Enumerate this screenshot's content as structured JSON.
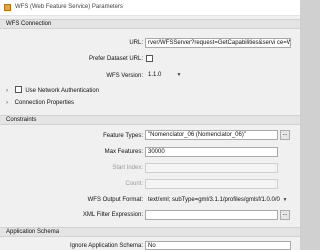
{
  "window": {
    "title": "WFS (Web Feature Service) Parameters"
  },
  "sections": {
    "wfs_connection": "WFS Connection",
    "constraints": "Constraints",
    "application_schema": "Application Schema"
  },
  "wfs_connection": {
    "url_label": "URL:",
    "url_value": "rver/WFSServer?request=GetCapabilities&servi ce=WFS",
    "prefer_dataset_url_label": "Prefer Dataset URL:",
    "prefer_dataset_url_checked": false,
    "wfs_version_label": "WFS Version:",
    "wfs_version_value": "1.1.0",
    "network_auth_label": "Use Network Authentication",
    "connection_properties_label": "Connection Properties"
  },
  "constraints": {
    "feature_types_label": "Feature Types:",
    "feature_types_value": "\"Nomenclator_06 (Nomenclator_06)\"",
    "max_features_label": "Max Features:",
    "max_features_value": "30000",
    "start_index_label": "Start Index:",
    "count_label": "Count:",
    "output_format_label": "WFS Output Format:",
    "output_format_value": "text/xml; subType=gml/3.1.1/profiles/gmlsf/1.0.0/0",
    "xml_filter_label": "XML Filter Expression:",
    "browse_label": "..."
  },
  "application_schema": {
    "ignore_label": "Ignore Application Schema:",
    "ignore_value": "No"
  },
  "icons": {
    "app": "fme-app-icon",
    "expand": "chevron-right-icon",
    "dropdown": "chevron-down-icon"
  },
  "colors": {
    "section_bg": "#e4e4e4",
    "window_bg": "#f0f0f0"
  }
}
